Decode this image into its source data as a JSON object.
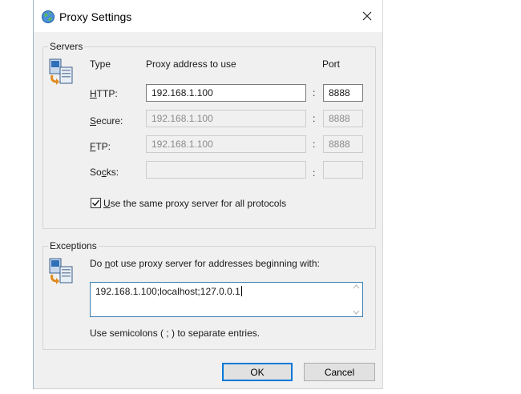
{
  "window": {
    "title": "Proxy Settings"
  },
  "servers": {
    "legend": "Servers",
    "col_type": "Type",
    "col_address": "Proxy address to use",
    "col_port": "Port",
    "rows": [
      {
        "label_acc": "H",
        "label_rest": "TTP:",
        "address": "192.168.1.100",
        "port": "8888",
        "enabled": true
      },
      {
        "label_acc": "S",
        "label_rest": "ecure:",
        "address": "192.168.1.100",
        "port": "8888",
        "enabled": false
      },
      {
        "label_acc": "F",
        "label_rest": "TP:",
        "address": "192.168.1.100",
        "port": "8888",
        "enabled": false
      },
      {
        "label_pre": "So",
        "label_acc": "c",
        "label_rest": "ks:",
        "address": "",
        "port": "",
        "enabled": false
      }
    ],
    "colon": ":",
    "same_proxy": {
      "acc": "U",
      "rest": "se the same proxy server for all protocols",
      "checked": true
    }
  },
  "exceptions": {
    "legend": "Exceptions",
    "desc_pre": "Do ",
    "desc_acc": "n",
    "desc_rest": "ot use proxy server for addresses beginning with:",
    "value": "192.168.1.100;localhost;127.0.0.1",
    "hint": "Use semicolons ( ; ) to separate entries."
  },
  "buttons": {
    "ok": "OK",
    "cancel": "Cancel"
  }
}
